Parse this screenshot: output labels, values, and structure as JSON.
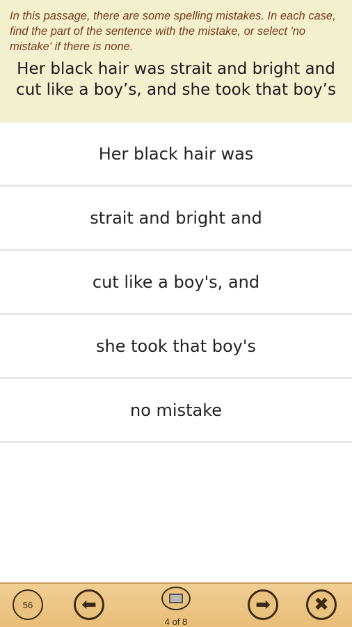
{
  "header": {
    "instructions": "In this passage, there are some spelling mistakes. In each case, find the part of the sentence with the mistake, or select 'no mistake' if there is none.",
    "passage": "Her black hair was strait and bright and cut like a boy’s, and she took that boy’s"
  },
  "options": [
    "Her black hair was",
    "strait and bright and",
    "cut like a boy's, and",
    "she took that boy's",
    "no mistake"
  ],
  "toolbar": {
    "timer": "56",
    "counter": "4 of 8",
    "icons": [
      "clock-icon",
      "arrow-left-icon",
      "list-icon",
      "arrow-right-icon",
      "close-icon"
    ],
    "accent_color": "#e9c27f"
  }
}
